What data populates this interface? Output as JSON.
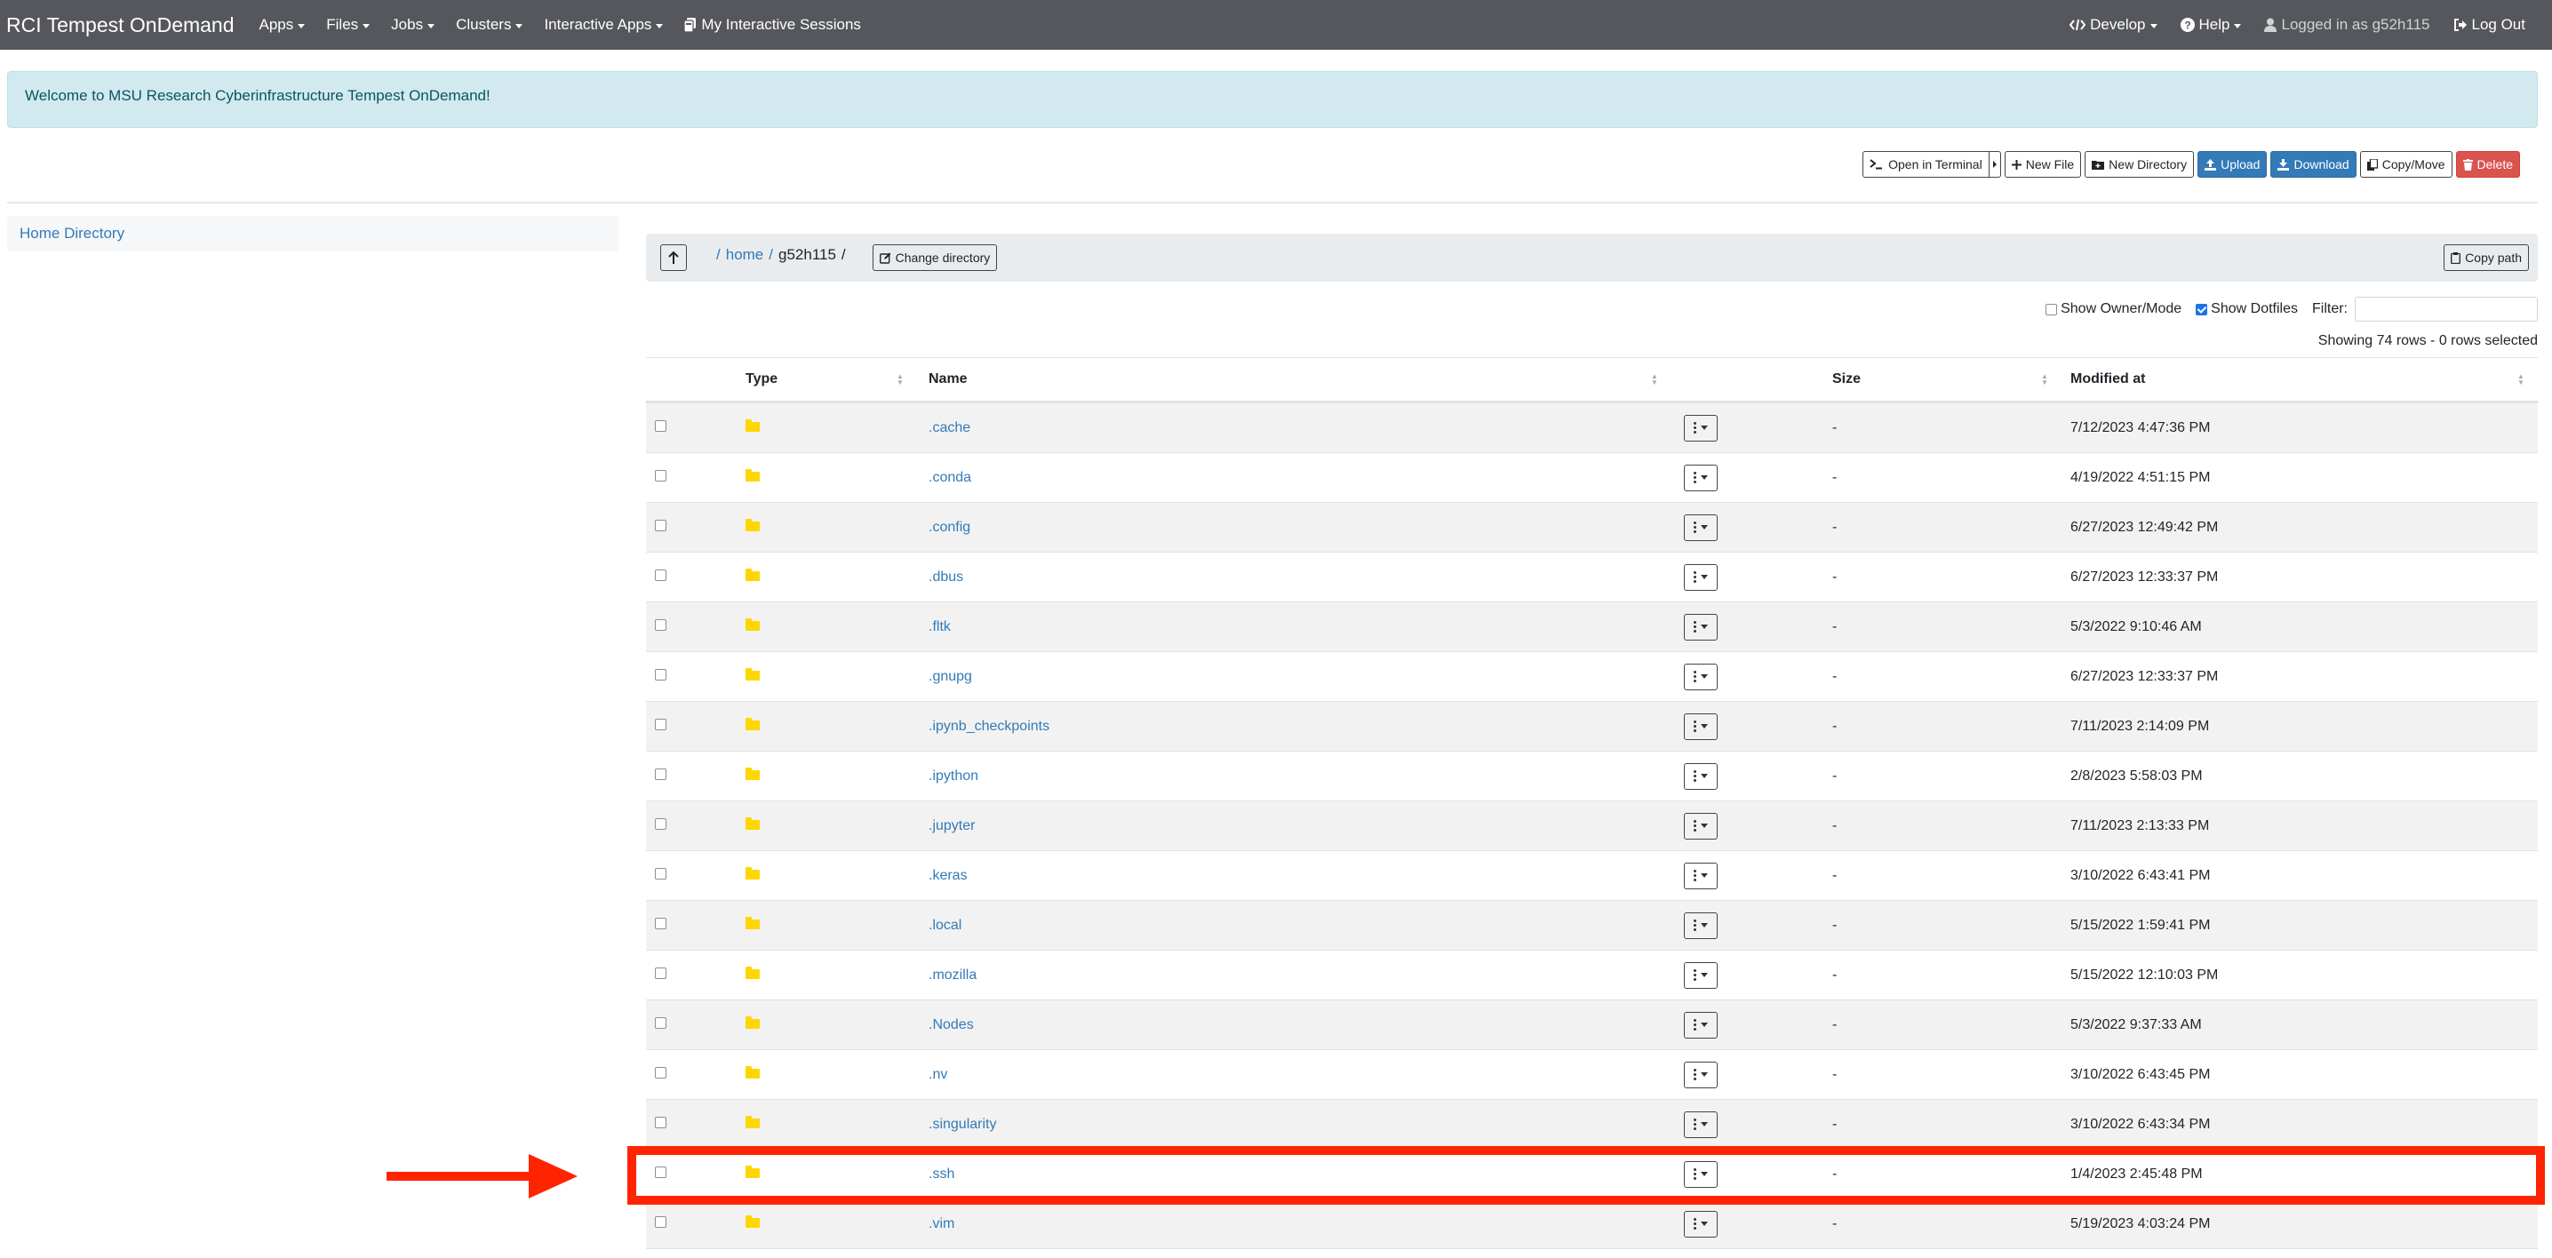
{
  "navbar": {
    "brand": "RCI Tempest OnDemand",
    "menus": [
      {
        "label": "Apps",
        "dropdown": true
      },
      {
        "label": "Files",
        "dropdown": true
      },
      {
        "label": "Jobs",
        "dropdown": true
      },
      {
        "label": "Clusters",
        "dropdown": true
      },
      {
        "label": "Interactive Apps",
        "dropdown": true
      }
    ],
    "sessions": {
      "label": "My Interactive Sessions",
      "icon": "sessions-icon"
    },
    "right": {
      "develop": {
        "label": "Develop",
        "icon": "code-icon"
      },
      "help": {
        "label": "Help",
        "icon": "question-circle-icon"
      },
      "user": {
        "label": "Logged in as g52h115",
        "icon": "user-icon"
      },
      "logout": {
        "label": "Log Out",
        "icon": "sign-out-icon"
      }
    }
  },
  "alert": {
    "message": "Welcome to MSU Research Cyberinfrastructure Tempest OnDemand!"
  },
  "toolbar": {
    "open_terminal": "Open in Terminal",
    "new_file": "New File",
    "new_directory": "New Directory",
    "upload": "Upload",
    "download": "Download",
    "copy_move": "Copy/Move",
    "delete": "Delete"
  },
  "sidebar": {
    "home_directory": "Home Directory"
  },
  "pathbar": {
    "crumbs": [
      {
        "label": "home",
        "link": true
      },
      {
        "label": "g52h115",
        "link": false
      }
    ],
    "change_directory": "Change directory",
    "copy_path": "Copy path"
  },
  "options": {
    "show_owner_mode": {
      "label": "Show Owner/Mode",
      "checked": false
    },
    "show_dotfiles": {
      "label": "Show Dotfiles",
      "checked": true
    },
    "filter_label": "Filter:",
    "filter_value": "",
    "showing": "Showing 74 rows - 0 rows selected"
  },
  "colors": {
    "accent": "#337ab7",
    "danger": "#d9534f",
    "folder": "#ffd600",
    "annotation": "#ff2400",
    "navbar": "#55575c"
  },
  "table": {
    "columns": {
      "type": "Type",
      "name": "Name",
      "size": "Size",
      "modified": "Modified at"
    },
    "rows": [
      {
        "name": ".cache",
        "size": "-",
        "modified": "7/12/2023 4:47:36 PM"
      },
      {
        "name": ".conda",
        "size": "-",
        "modified": "4/19/2022 4:51:15 PM"
      },
      {
        "name": ".config",
        "size": "-",
        "modified": "6/27/2023 12:49:42 PM"
      },
      {
        "name": ".dbus",
        "size": "-",
        "modified": "6/27/2023 12:33:37 PM"
      },
      {
        "name": ".fltk",
        "size": "-",
        "modified": "5/3/2022 9:10:46 AM"
      },
      {
        "name": ".gnupg",
        "size": "-",
        "modified": "6/27/2023 12:33:37 PM"
      },
      {
        "name": ".ipynb_checkpoints",
        "size": "-",
        "modified": "7/11/2023 2:14:09 PM"
      },
      {
        "name": ".ipython",
        "size": "-",
        "modified": "2/8/2023 5:58:03 PM"
      },
      {
        "name": ".jupyter",
        "size": "-",
        "modified": "7/11/2023 2:13:33 PM"
      },
      {
        "name": ".keras",
        "size": "-",
        "modified": "3/10/2022 6:43:41 PM"
      },
      {
        "name": ".local",
        "size": "-",
        "modified": "5/15/2022 1:59:41 PM"
      },
      {
        "name": ".mozilla",
        "size": "-",
        "modified": "5/15/2022 12:10:03 PM"
      },
      {
        "name": ".Nodes",
        "size": "-",
        "modified": "5/3/2022 9:37:33 AM"
      },
      {
        "name": ".nv",
        "size": "-",
        "modified": "3/10/2022 6:43:45 PM"
      },
      {
        "name": ".singularity",
        "size": "-",
        "modified": "3/10/2022 6:43:34 PM"
      },
      {
        "name": ".ssh",
        "size": "-",
        "modified": "1/4/2023 2:45:48 PM",
        "highlighted": true
      },
      {
        "name": ".vim",
        "size": "-",
        "modified": "5/19/2023 4:03:24 PM"
      }
    ]
  }
}
